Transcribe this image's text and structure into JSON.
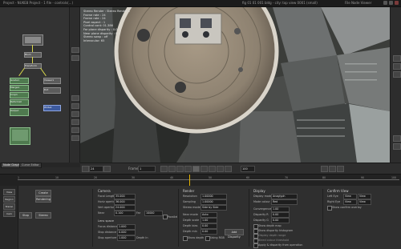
{
  "titlebar": {
    "left_text": "Project - NUKE8 Project - 1 file - controls(...)",
    "mid_text": "fig 01 01 001 bldg - city: top view 0001 (small)",
    "right_text": "File  Node  Viewer"
  },
  "node_graph": {
    "nodes": [
      {
        "label": "Read1",
        "kind": "gray"
      },
      {
        "label": "Blur1",
        "kind": "gray"
      },
      {
        "label": "Transform",
        "kind": "gray"
      },
      {
        "label": "Grade1",
        "kind": "green"
      },
      {
        "label": "Merge1",
        "kind": "green"
      },
      {
        "label": "Crop1",
        "kind": "green"
      },
      {
        "label": "Reformat",
        "kind": "green"
      },
      {
        "label": "Viewer1",
        "kind": "gray"
      },
      {
        "label": "Write1",
        "kind": "blue"
      },
      {
        "label": "Dot",
        "kind": "gray"
      },
      {
        "label": "Output",
        "kind": "green"
      }
    ]
  },
  "viewer": {
    "info_lines": [
      "Stereo Render : Stereo Render 1",
      "Frame rate : 24",
      "Frame rate : 24",
      "Pixel aspect : 1",
      "Control cont: 01.386",
      "Far plane disparity : 0.0",
      "Near plane disparity : 0",
      "Stereo swap : off",
      "Interocular: 65"
    ]
  },
  "graph_tabs": [
    "Node Graph",
    "Curve Editor"
  ],
  "transport": {
    "fps_value": "24",
    "frame_value": "1",
    "frame_label": "Frame",
    "end_value": "100"
  },
  "timeline": {
    "ticks": [
      "1",
      "10",
      "20",
      "30",
      "40",
      "50",
      "60",
      "70",
      "80",
      "90",
      "100"
    ],
    "playhead_frac": 0.45
  },
  "props": {
    "side_tools": [
      "View",
      "Region",
      "Stereo",
      "Cam"
    ],
    "action_buttons": [
      "Create",
      "Rendering",
      "Stop",
      "Stereo"
    ],
    "sections": {
      "camera": {
        "title": "Camera",
        "rows": [
          {
            "label": "Focal Length",
            "value": "35.000"
          },
          {
            "label": "Horiz aperture",
            "value": "36.000"
          },
          {
            "label": "Vert aperture",
            "value": "24.000"
          },
          {
            "label": "Near",
            "value": "0.100"
          },
          {
            "label": "Far",
            "value": "10000"
          }
        ],
        "extra_label": "Interocular",
        "extra_check": "Parallel",
        "sub_title": "Lens space",
        "sub_rows": [
          {
            "label": "Focus distance",
            "value": "1.000"
          },
          {
            "label": "Stop distance",
            "value": "0.000"
          },
          {
            "label": "Stop aperture",
            "value": "1.000"
          }
        ],
        "depth_label": "Depth in"
      },
      "render": {
        "title": "Render",
        "rows": [
          {
            "label": "Resolution",
            "value": "1.00000"
          },
          {
            "label": "Sampling",
            "value": "1.00000"
          },
          {
            "label": "Stereo mode",
            "value": "Side by Side"
          }
        ],
        "rows2": [
          {
            "label": "Near mode",
            "value": "Auto"
          },
          {
            "label": "Depth scale",
            "value": "1.00"
          },
          {
            "label": "Depth bias",
            "value": "0.00"
          },
          {
            "label": "Depth min",
            "value": "0.00"
          }
        ],
        "checks": [
          "Show depth",
          "Using RGB"
        ],
        "apply_button": "Add Disparity"
      },
      "display": {
        "title": "Display",
        "rows": [
          {
            "label": "Display mode",
            "value": "Anaglyph"
          },
          {
            "label": "Mode colour",
            "value": "Red"
          }
        ],
        "rows2": [
          {
            "label": "Convergence",
            "value": "1.00"
          },
          {
            "label": "Disparity R",
            "value": "0.00"
          },
          {
            "label": "Disparity G",
            "value": "0.00"
          }
        ],
        "checks": [
          "Show depth map",
          "Show disparity histogram",
          "Display depth range",
          "Bleed colour threshold",
          "Apply & disparity from operation"
        ]
      },
      "confirm": {
        "title": "Confirm View",
        "rows": [
          {
            "label": "Left Eye",
            "value": "View"
          },
          {
            "label": "Right Eye",
            "value": "View"
          }
        ],
        "check": "Show confirm overlay"
      }
    }
  }
}
